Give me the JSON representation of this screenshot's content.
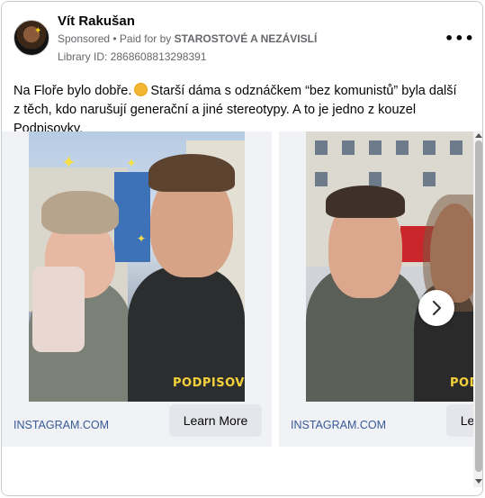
{
  "header": {
    "name": "Vít Rakušan",
    "sponsored": "Sponsored",
    "separator": " • ",
    "paid_for_by_label": "Paid for by ",
    "paid_for_by": "STAROSTOVÉ A NEZÁVISLÍ",
    "library_id": "Library ID: 2868608813298391",
    "more_options": "•••"
  },
  "post": {
    "text_part1": "Na Floře bylo dobře. ",
    "text_part2": " Starší dáma s odznáčkem “bez komunistů” byla další z těch, kdo narušují generační a jiné stereotypy. A to je jedno z kouzel Podpisovky."
  },
  "carousel": {
    "cards": [
      {
        "caption": "INSTAGRAM.COM",
        "button": "Learn More",
        "overlay_text": "PODPISOVKA"
      },
      {
        "caption": "INSTAGRAM.COM",
        "button": "Learn More",
        "overlay_text": "PODPISOVKA"
      }
    ]
  },
  "colors": {
    "link": "#385898",
    "button_bg": "#e4e6eb",
    "muted": "#65676b",
    "overlay_yellow": "#f4d23a"
  },
  "icons": {
    "next": "chevron-right-icon",
    "more": "more-horizontal-icon"
  }
}
